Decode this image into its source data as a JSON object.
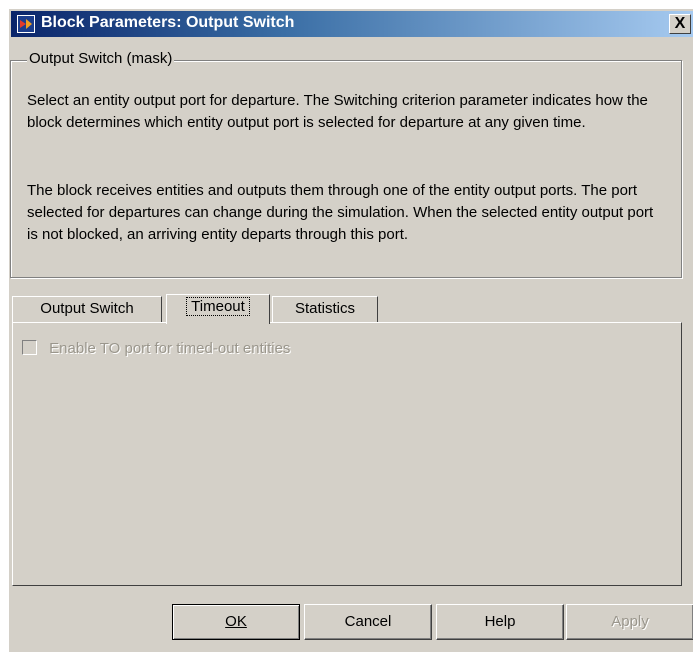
{
  "window": {
    "title": "Block Parameters: Output Switch",
    "close_label": "X"
  },
  "group": {
    "label": "Output Switch (mask)",
    "description_1": "Select an entity output port for departure. The Switching criterion parameter indicates how the block determines which entity output port is selected for departure at any given time.",
    "description_2": "The block receives entities and outputs them through one of the entity output ports. The port selected for departures can change during the simulation. When the selected entity output port is not blocked, an arriving entity departs through this port."
  },
  "tabs": [
    {
      "label": "Output Switch"
    },
    {
      "label": "Timeout",
      "selected": true
    },
    {
      "label": "Statistics"
    }
  ],
  "timeout_tab": {
    "checkbox_label": "Enable TO port for timed-out entities",
    "checked": false,
    "enabled": false
  },
  "buttons": {
    "ok": "OK",
    "cancel": "Cancel",
    "help": "Help",
    "apply": "Apply"
  },
  "colors": {
    "dialog_bg": "#d4d0c8",
    "titlebar_start": "#0a246a",
    "titlebar_end": "#a6caf0"
  }
}
